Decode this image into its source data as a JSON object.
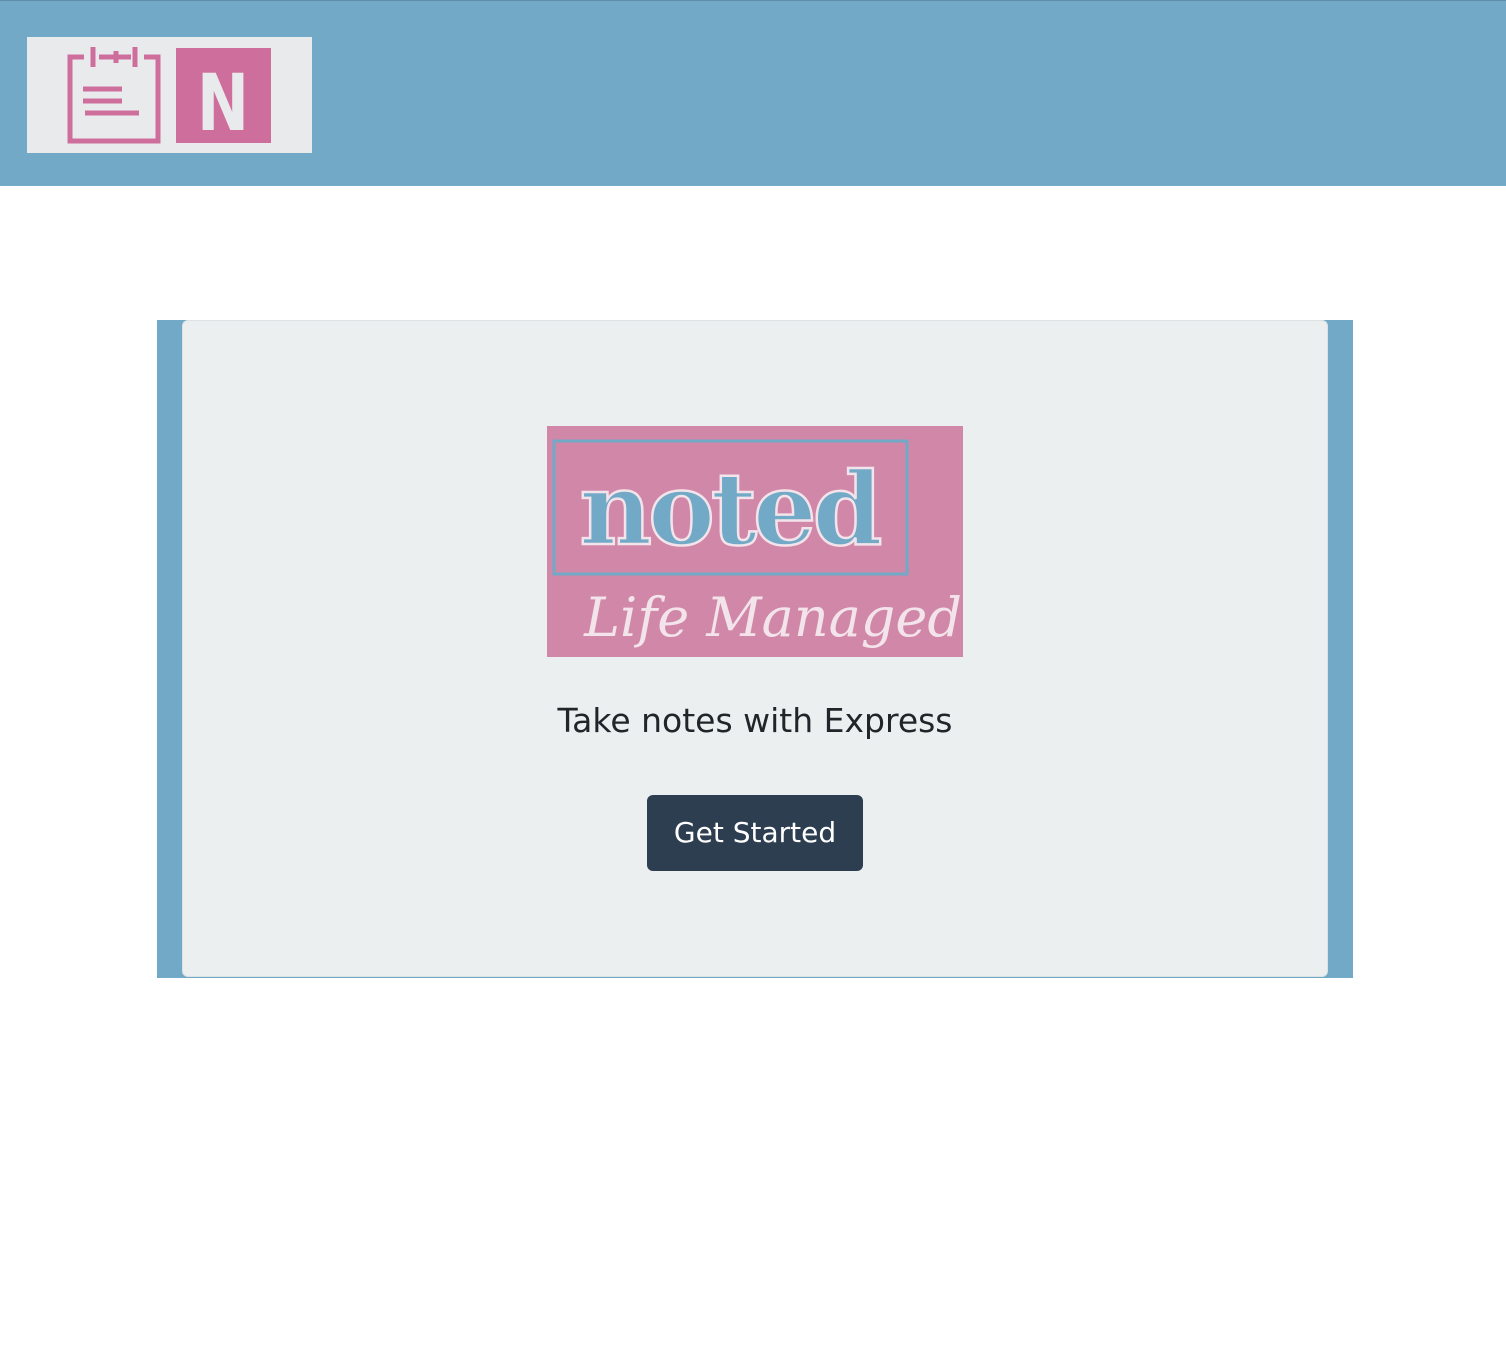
{
  "header": {
    "logo": {
      "icon": "notepad-icon",
      "letter": "N",
      "colors": {
        "pink": "#cd6e9c",
        "light": "#e9eaeb"
      }
    },
    "background_color": "#71a9c6"
  },
  "hero": {
    "logo": {
      "wordmark": "noted",
      "slogan": "Life Managed",
      "colors": {
        "pink": "#d188a8",
        "blue": "#71a9c6",
        "cream": "#f3e3ea"
      }
    },
    "tagline": "Take notes with Express",
    "cta_label": "Get Started",
    "cta_color": "#2c3e50"
  }
}
